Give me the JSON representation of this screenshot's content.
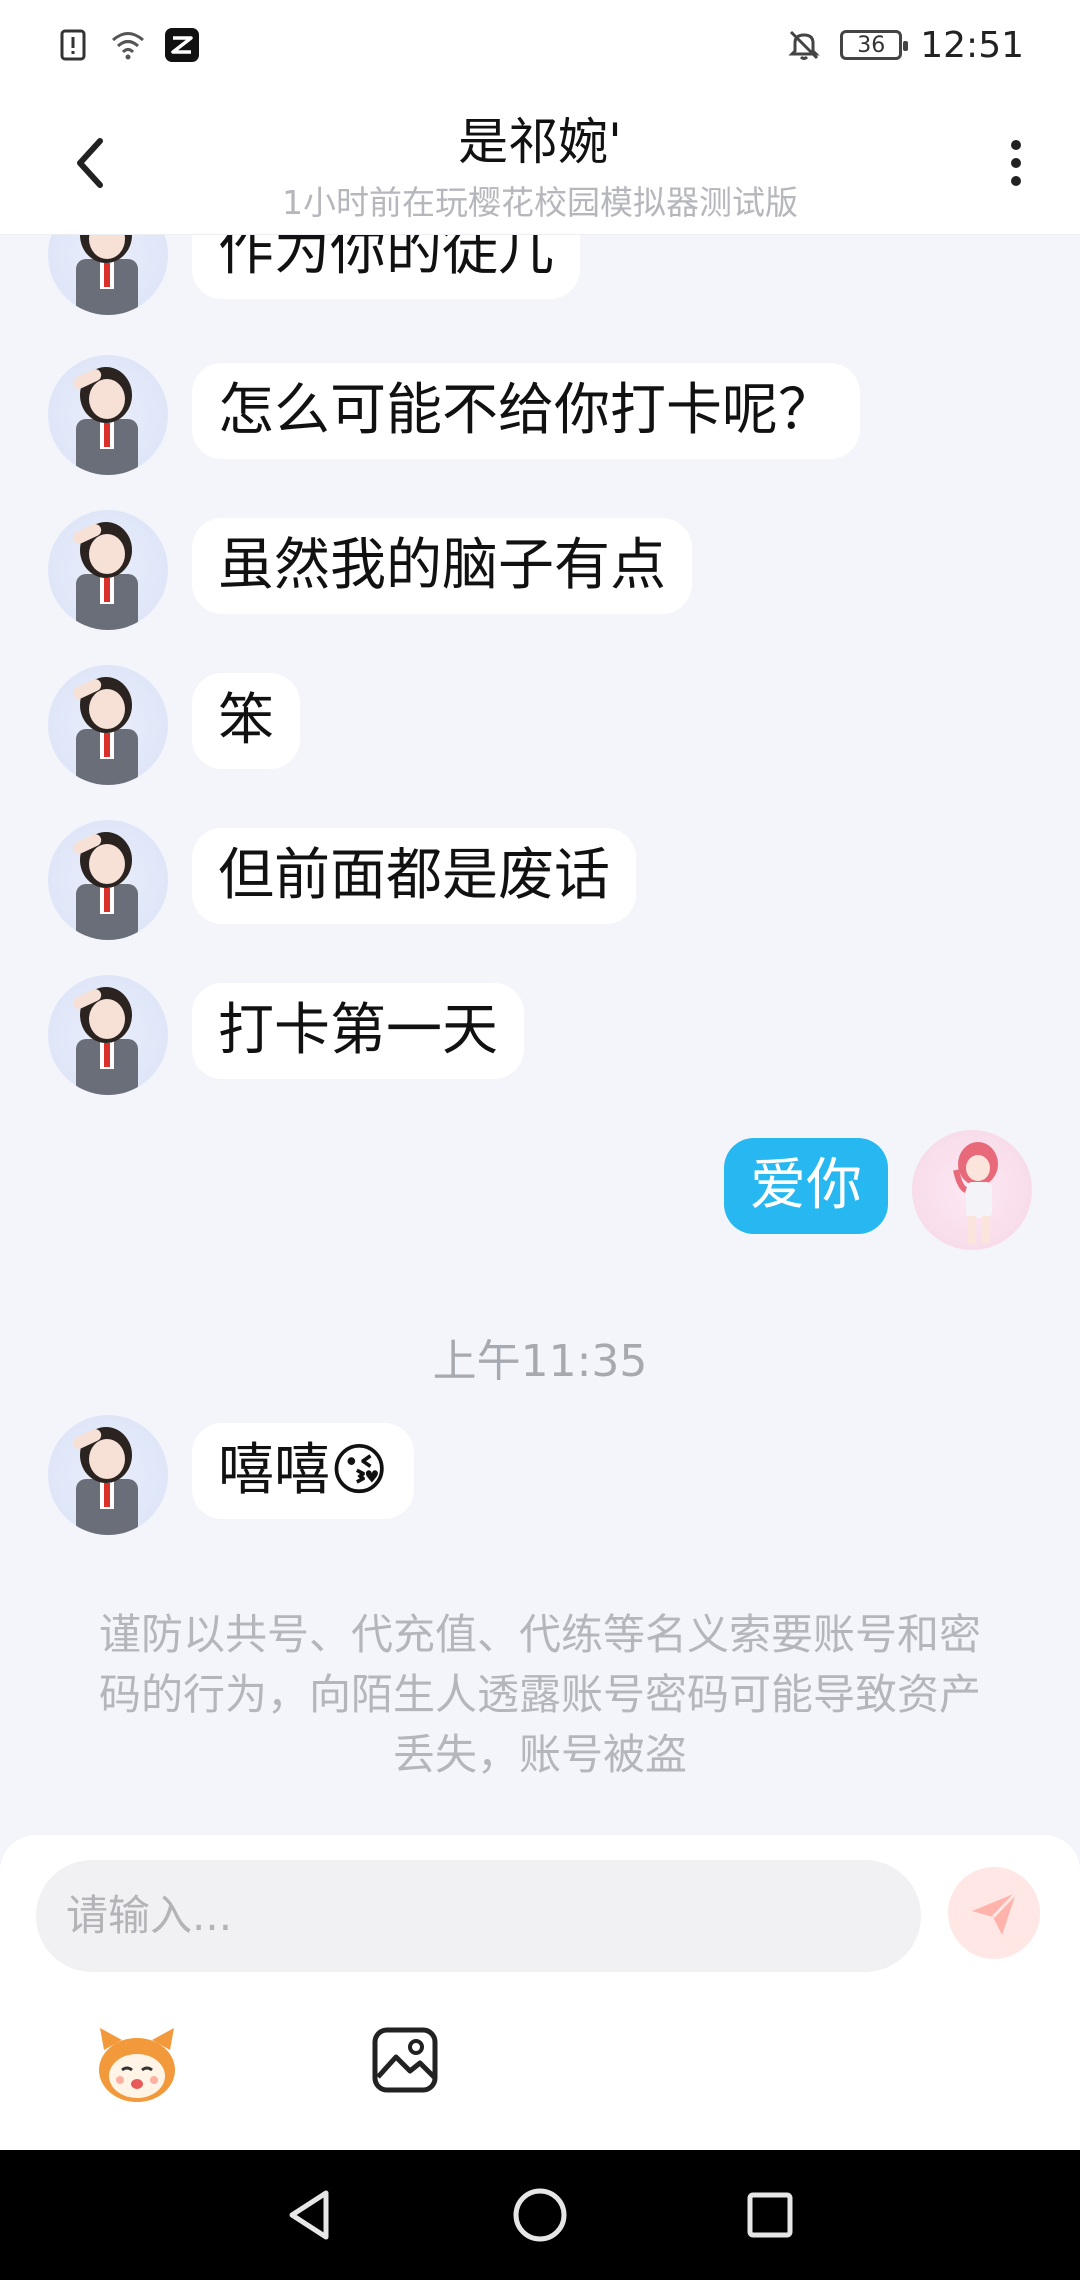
{
  "status_bar": {
    "time": "12:51",
    "battery": "36",
    "icons": [
      "alert-icon",
      "wifi-icon",
      "capcut-app-icon",
      "bell-off-icon",
      "battery-icon"
    ]
  },
  "header": {
    "title": "是祁婉'",
    "subtitle": "1小时前在玩樱花校园模拟器测试版",
    "back_icon": "chevron-left-icon",
    "more_icon": "more-vertical-icon"
  },
  "messages": [
    {
      "side": "left",
      "text": "作为你的徒儿"
    },
    {
      "side": "left",
      "text": "怎么可能不给你打卡呢？"
    },
    {
      "side": "left",
      "text": "虽然我的脑子有点"
    },
    {
      "side": "left",
      "text": "笨"
    },
    {
      "side": "left",
      "text": "但前面都是废话"
    },
    {
      "side": "left",
      "text": "打卡第一天"
    },
    {
      "side": "right",
      "text": "爱你"
    },
    {
      "side": "left",
      "text": "嘻嘻😘"
    }
  ],
  "timestamp": "上午11:35",
  "notice": "谨防以共号、代充值、代练等名义索要账号和密码的行为，向陌生人透露账号密码可能导致资产丢失，账号被盗",
  "input": {
    "placeholder": "请输入...",
    "send_icon": "send-icon"
  },
  "toolbar": {
    "emoji_icon": "sticker-face-icon",
    "image_icon": "image-icon"
  },
  "nav": {
    "back": "nav-back-icon",
    "home": "nav-home-icon",
    "recents": "nav-recents-icon"
  },
  "colors": {
    "accent": "#27b8f1",
    "background": "#f3f5fa",
    "send_button": "#ffe7e5"
  }
}
